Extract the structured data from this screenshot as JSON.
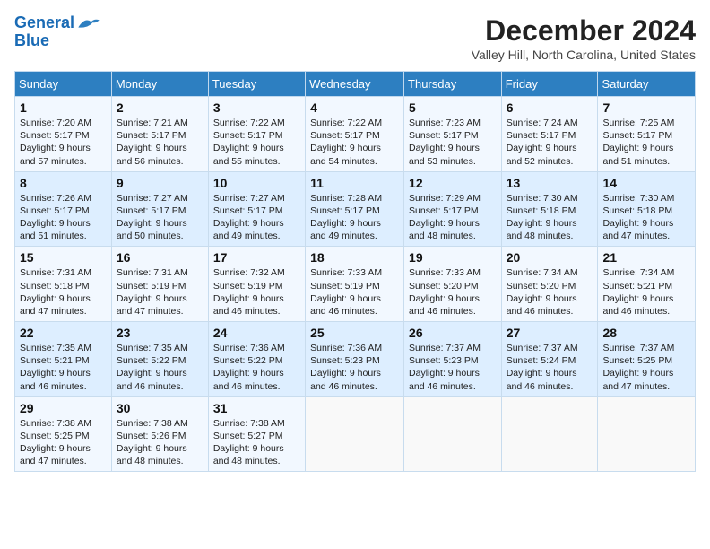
{
  "logo": {
    "text1": "General",
    "text2": "Blue"
  },
  "header": {
    "month_year": "December 2024",
    "location": "Valley Hill, North Carolina, United States"
  },
  "weekdays": [
    "Sunday",
    "Monday",
    "Tuesday",
    "Wednesday",
    "Thursday",
    "Friday",
    "Saturday"
  ],
  "weeks": [
    [
      {
        "day": "1",
        "lines": [
          "Sunrise: 7:20 AM",
          "Sunset: 5:17 PM",
          "Daylight: 9 hours",
          "and 57 minutes."
        ]
      },
      {
        "day": "2",
        "lines": [
          "Sunrise: 7:21 AM",
          "Sunset: 5:17 PM",
          "Daylight: 9 hours",
          "and 56 minutes."
        ]
      },
      {
        "day": "3",
        "lines": [
          "Sunrise: 7:22 AM",
          "Sunset: 5:17 PM",
          "Daylight: 9 hours",
          "and 55 minutes."
        ]
      },
      {
        "day": "4",
        "lines": [
          "Sunrise: 7:22 AM",
          "Sunset: 5:17 PM",
          "Daylight: 9 hours",
          "and 54 minutes."
        ]
      },
      {
        "day": "5",
        "lines": [
          "Sunrise: 7:23 AM",
          "Sunset: 5:17 PM",
          "Daylight: 9 hours",
          "and 53 minutes."
        ]
      },
      {
        "day": "6",
        "lines": [
          "Sunrise: 7:24 AM",
          "Sunset: 5:17 PM",
          "Daylight: 9 hours",
          "and 52 minutes."
        ]
      },
      {
        "day": "7",
        "lines": [
          "Sunrise: 7:25 AM",
          "Sunset: 5:17 PM",
          "Daylight: 9 hours",
          "and 51 minutes."
        ]
      }
    ],
    [
      {
        "day": "8",
        "lines": [
          "Sunrise: 7:26 AM",
          "Sunset: 5:17 PM",
          "Daylight: 9 hours",
          "and 51 minutes."
        ]
      },
      {
        "day": "9",
        "lines": [
          "Sunrise: 7:27 AM",
          "Sunset: 5:17 PM",
          "Daylight: 9 hours",
          "and 50 minutes."
        ]
      },
      {
        "day": "10",
        "lines": [
          "Sunrise: 7:27 AM",
          "Sunset: 5:17 PM",
          "Daylight: 9 hours",
          "and 49 minutes."
        ]
      },
      {
        "day": "11",
        "lines": [
          "Sunrise: 7:28 AM",
          "Sunset: 5:17 PM",
          "Daylight: 9 hours",
          "and 49 minutes."
        ]
      },
      {
        "day": "12",
        "lines": [
          "Sunrise: 7:29 AM",
          "Sunset: 5:17 PM",
          "Daylight: 9 hours",
          "and 48 minutes."
        ]
      },
      {
        "day": "13",
        "lines": [
          "Sunrise: 7:30 AM",
          "Sunset: 5:18 PM",
          "Daylight: 9 hours",
          "and 48 minutes."
        ]
      },
      {
        "day": "14",
        "lines": [
          "Sunrise: 7:30 AM",
          "Sunset: 5:18 PM",
          "Daylight: 9 hours",
          "and 47 minutes."
        ]
      }
    ],
    [
      {
        "day": "15",
        "lines": [
          "Sunrise: 7:31 AM",
          "Sunset: 5:18 PM",
          "Daylight: 9 hours",
          "and 47 minutes."
        ]
      },
      {
        "day": "16",
        "lines": [
          "Sunrise: 7:31 AM",
          "Sunset: 5:19 PM",
          "Daylight: 9 hours",
          "and 47 minutes."
        ]
      },
      {
        "day": "17",
        "lines": [
          "Sunrise: 7:32 AM",
          "Sunset: 5:19 PM",
          "Daylight: 9 hours",
          "and 46 minutes."
        ]
      },
      {
        "day": "18",
        "lines": [
          "Sunrise: 7:33 AM",
          "Sunset: 5:19 PM",
          "Daylight: 9 hours",
          "and 46 minutes."
        ]
      },
      {
        "day": "19",
        "lines": [
          "Sunrise: 7:33 AM",
          "Sunset: 5:20 PM",
          "Daylight: 9 hours",
          "and 46 minutes."
        ]
      },
      {
        "day": "20",
        "lines": [
          "Sunrise: 7:34 AM",
          "Sunset: 5:20 PM",
          "Daylight: 9 hours",
          "and 46 minutes."
        ]
      },
      {
        "day": "21",
        "lines": [
          "Sunrise: 7:34 AM",
          "Sunset: 5:21 PM",
          "Daylight: 9 hours",
          "and 46 minutes."
        ]
      }
    ],
    [
      {
        "day": "22",
        "lines": [
          "Sunrise: 7:35 AM",
          "Sunset: 5:21 PM",
          "Daylight: 9 hours",
          "and 46 minutes."
        ]
      },
      {
        "day": "23",
        "lines": [
          "Sunrise: 7:35 AM",
          "Sunset: 5:22 PM",
          "Daylight: 9 hours",
          "and 46 minutes."
        ]
      },
      {
        "day": "24",
        "lines": [
          "Sunrise: 7:36 AM",
          "Sunset: 5:22 PM",
          "Daylight: 9 hours",
          "and 46 minutes."
        ]
      },
      {
        "day": "25",
        "lines": [
          "Sunrise: 7:36 AM",
          "Sunset: 5:23 PM",
          "Daylight: 9 hours",
          "and 46 minutes."
        ]
      },
      {
        "day": "26",
        "lines": [
          "Sunrise: 7:37 AM",
          "Sunset: 5:23 PM",
          "Daylight: 9 hours",
          "and 46 minutes."
        ]
      },
      {
        "day": "27",
        "lines": [
          "Sunrise: 7:37 AM",
          "Sunset: 5:24 PM",
          "Daylight: 9 hours",
          "and 46 minutes."
        ]
      },
      {
        "day": "28",
        "lines": [
          "Sunrise: 7:37 AM",
          "Sunset: 5:25 PM",
          "Daylight: 9 hours",
          "and 47 minutes."
        ]
      }
    ],
    [
      {
        "day": "29",
        "lines": [
          "Sunrise: 7:38 AM",
          "Sunset: 5:25 PM",
          "Daylight: 9 hours",
          "and 47 minutes."
        ]
      },
      {
        "day": "30",
        "lines": [
          "Sunrise: 7:38 AM",
          "Sunset: 5:26 PM",
          "Daylight: 9 hours",
          "and 48 minutes."
        ]
      },
      {
        "day": "31",
        "lines": [
          "Sunrise: 7:38 AM",
          "Sunset: 5:27 PM",
          "Daylight: 9 hours",
          "and 48 minutes."
        ]
      },
      null,
      null,
      null,
      null
    ]
  ]
}
